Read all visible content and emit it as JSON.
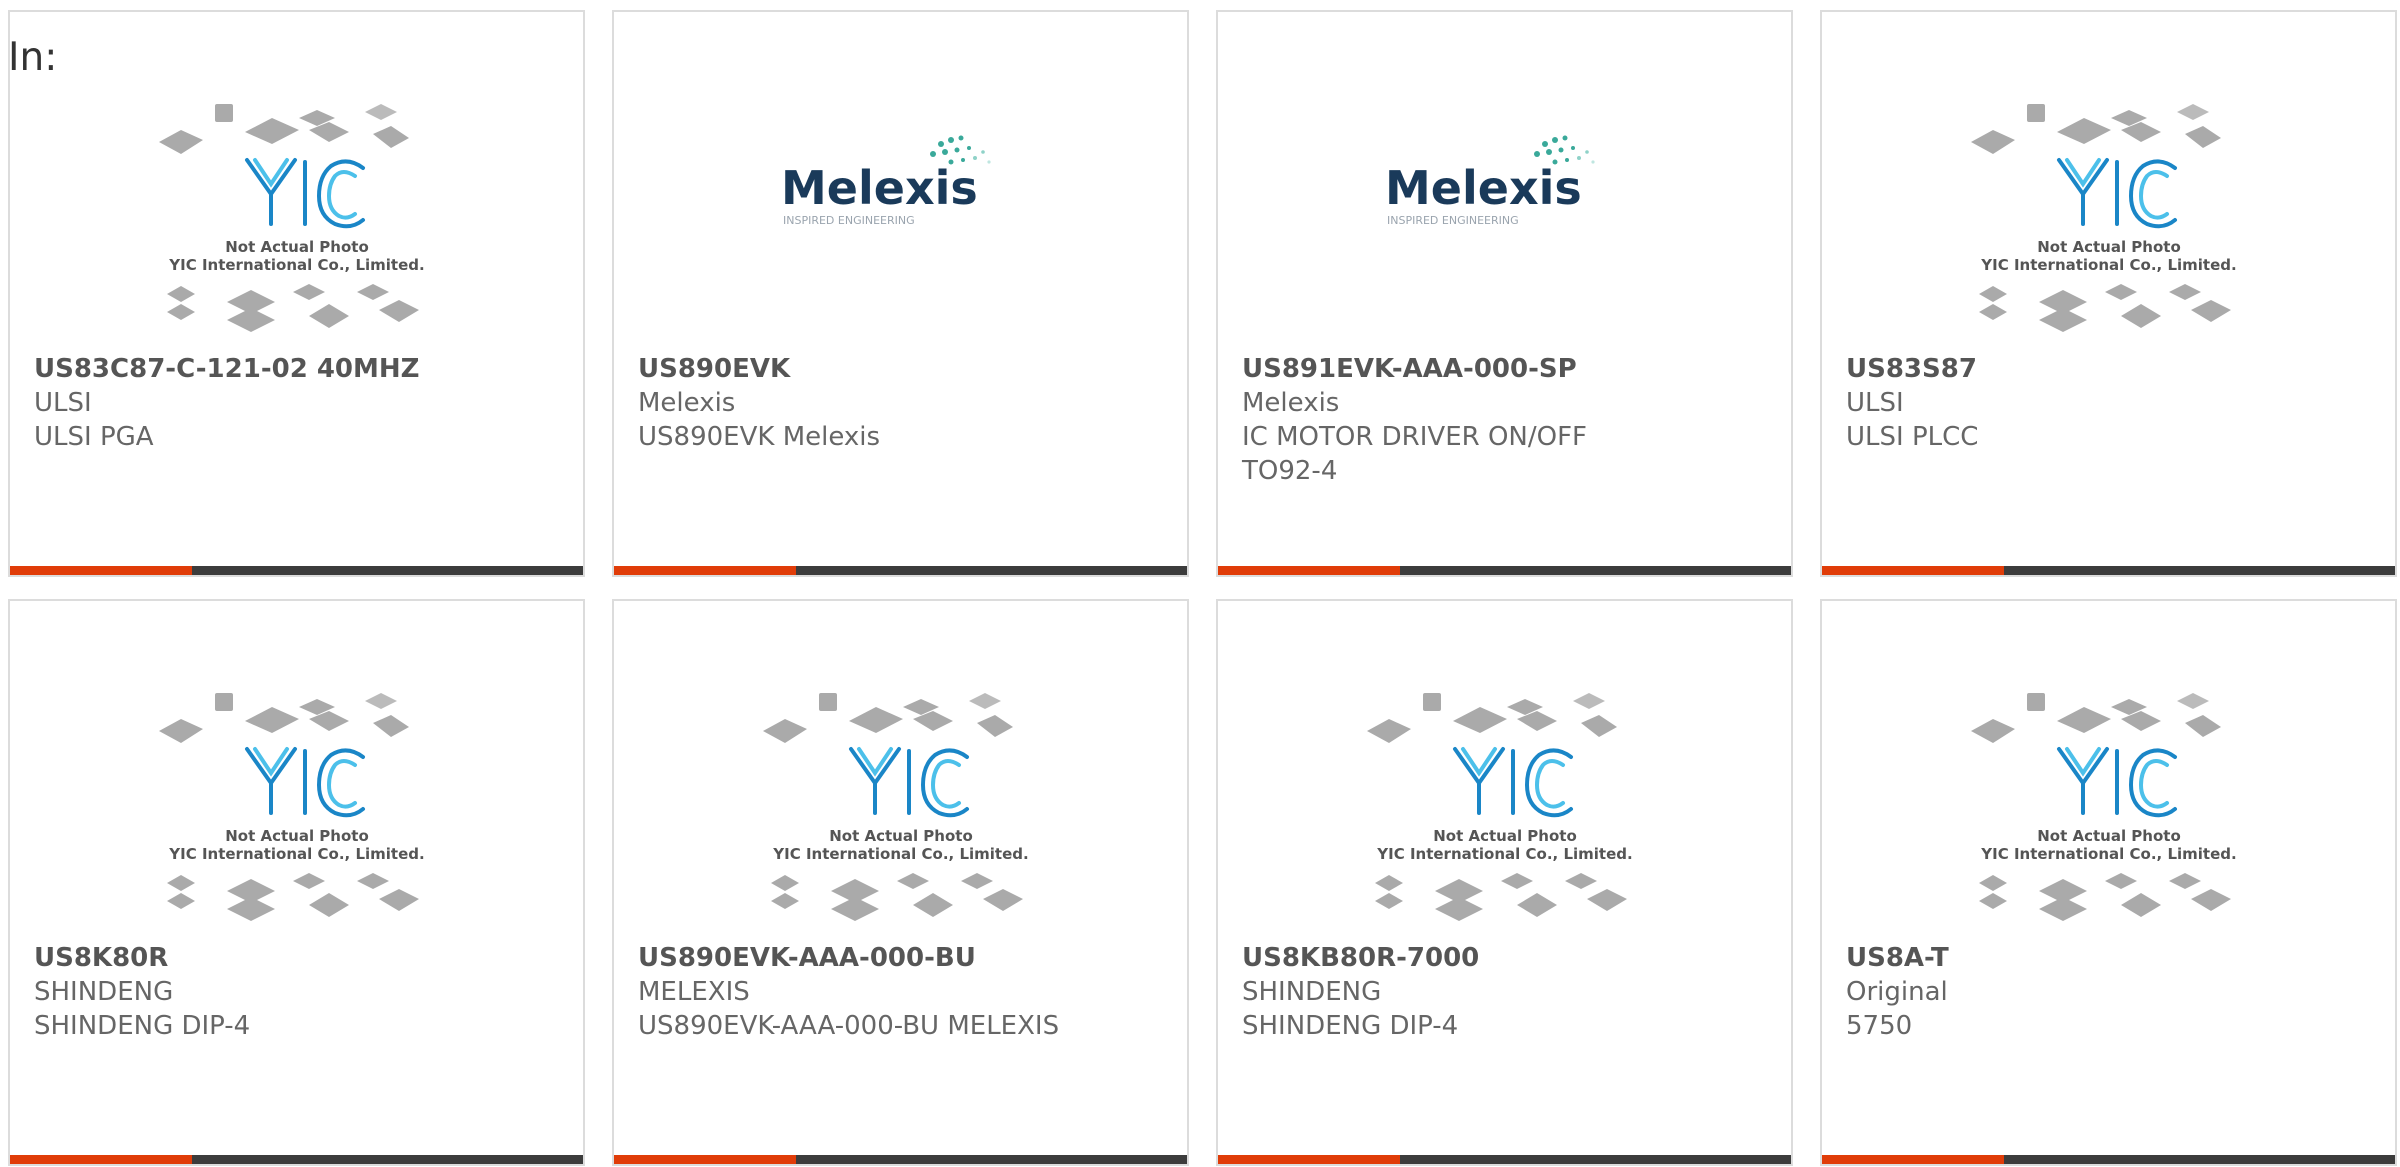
{
  "header": {
    "label": "In:"
  },
  "brand_colors": {
    "accent": "#e03c08",
    "bar_dark": "#3c3c3c",
    "yic_blue": "#1a86c7",
    "melexis_navy": "#1a3a5a",
    "melexis_teal": "#3aa99a"
  },
  "placeholder": {
    "caption_line1": "Not Actual Photo",
    "caption_line2": "YIC International Co., Limited.",
    "logo_text": "YIC"
  },
  "melexis_logo": {
    "name": "Melexis",
    "tagline": "INSPIRED ENGINEERING"
  },
  "cards": [
    {
      "part": "US83C87-C-121-02 40MHZ",
      "maker": "ULSI",
      "desc": "ULSI PGA",
      "image": "placeholder"
    },
    {
      "part": "US890EVK",
      "maker": "Melexis",
      "desc": "US890EVK Melexis",
      "image": "melexis"
    },
    {
      "part": "US891EVK-AAA-000-SP",
      "maker": "Melexis",
      "desc": "IC MOTOR DRIVER ON/OFF TO92-4",
      "image": "melexis"
    },
    {
      "part": "US83S87",
      "maker": "ULSI",
      "desc": "ULSI PLCC",
      "image": "placeholder"
    },
    {
      "part": "US8K80R",
      "maker": "SHINDENG",
      "desc": "SHINDENG DIP-4",
      "image": "placeholder"
    },
    {
      "part": "US890EVK-AAA-000-BU",
      "maker": "MELEXIS",
      "desc": "US890EVK-AAA-000-BU MELEXIS",
      "image": "placeholder"
    },
    {
      "part": "US8KB80R-7000",
      "maker": "SHINDENG",
      "desc": "SHINDENG DIP-4",
      "image": "placeholder"
    },
    {
      "part": "US8A-T",
      "maker": "Original",
      "desc": "5750",
      "image": "placeholder"
    }
  ]
}
